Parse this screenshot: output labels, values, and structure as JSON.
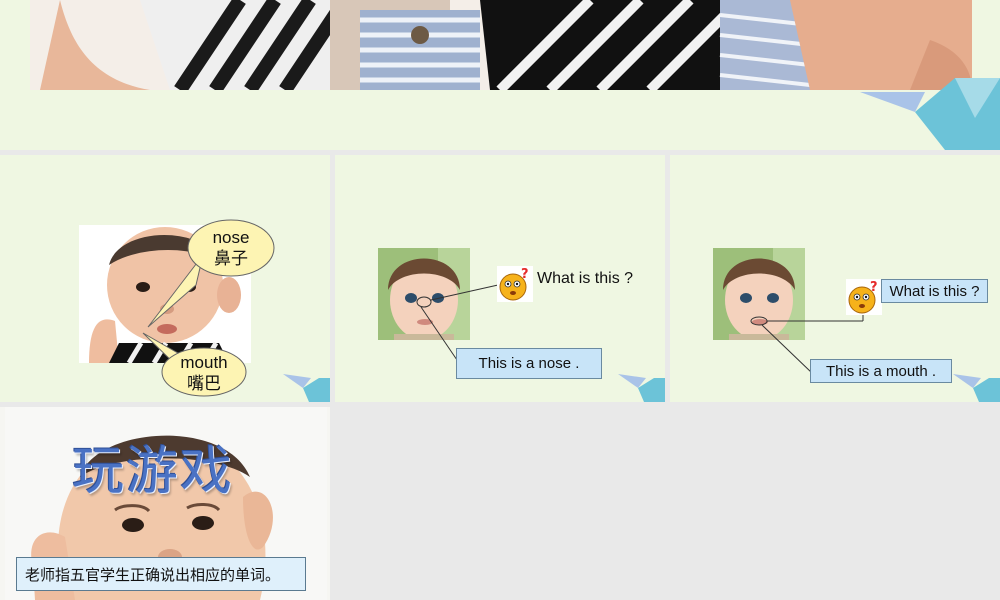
{
  "colors": {
    "slide_bg": "#eff7e2",
    "gap_bg": "#e9e9e9",
    "callout_bg": "#c8e4f8",
    "title_blue": "#4a72c4",
    "bubble_yellow": "#fdf4b3"
  },
  "slide2": {
    "nose_en": "nose",
    "nose_zh": "鼻子",
    "mouth_en": "mouth",
    "mouth_zh": "嘴巴"
  },
  "slide3": {
    "question": "What is this ?",
    "answer": "This is a nose ."
  },
  "slide4": {
    "question": "What is this ?",
    "answer": "This is a mouth ."
  },
  "slide5": {
    "title": "玩游戏",
    "instruction": "老师指五官学生正确说出相应的单词。"
  },
  "icons": {
    "question_face": "question-face-icon",
    "deco": "geometric-deco"
  }
}
